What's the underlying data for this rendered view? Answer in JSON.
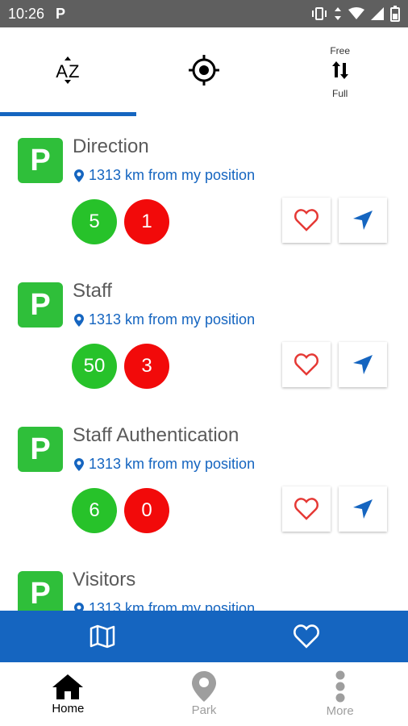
{
  "status_bar": {
    "time": "10:26",
    "app_icon_letter": "P"
  },
  "toolbar": {
    "az_label": "AZ",
    "free_label": "Free",
    "full_label": "Full"
  },
  "parkings": [
    {
      "logo": "P",
      "name": "Direction",
      "distance": "1313 km from my position",
      "free": "5",
      "full": "1"
    },
    {
      "logo": "P",
      "name": "Staff",
      "distance": "1313 km from my position",
      "free": "50",
      "full": "3"
    },
    {
      "logo": "P",
      "name": "Staff Authentication",
      "distance": "1313 km from my position",
      "free": "6",
      "full": "0"
    },
    {
      "logo": "P",
      "name": "Visitors",
      "distance": "1313 km from my position",
      "free": "",
      "full": ""
    }
  ],
  "bottom_nav": {
    "home_label": "Home",
    "park_label": "Park",
    "more_label": "More"
  },
  "colors": {
    "primary": "#1565c0",
    "green": "#2fbf3a",
    "red": "#f20a0a"
  }
}
